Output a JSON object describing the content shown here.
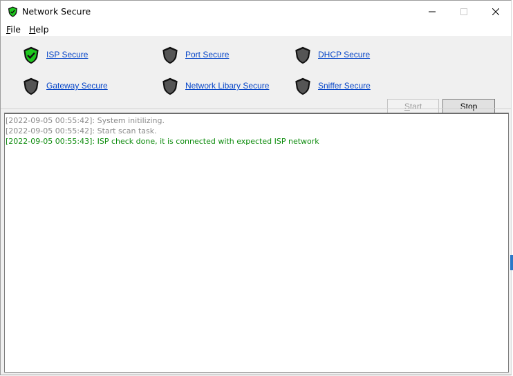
{
  "window": {
    "title": "Network Secure"
  },
  "menu": {
    "items": [
      {
        "accel": "F",
        "rest": "ile"
      },
      {
        "accel": "H",
        "rest": "elp"
      }
    ]
  },
  "checks": [
    {
      "label": "ISP Secure",
      "status": "passed"
    },
    {
      "label": "Port Secure",
      "status": "pending"
    },
    {
      "label": "DHCP Secure",
      "status": "pending"
    },
    {
      "label": "Gateway Secure",
      "status": "pending"
    },
    {
      "label": "Network Libary Secure",
      "status": "pending"
    },
    {
      "label": "Sniffer Secure",
      "status": "pending"
    }
  ],
  "buttons": {
    "start_accel": "S",
    "start_rest": "tart",
    "start_enabled": false,
    "stop_label": "Stop"
  },
  "log": [
    {
      "text": "[2022-09-05 00:55:42]: System initilizing.",
      "color": "#8a8a8a"
    },
    {
      "text": "[2022-09-05 00:55:42]: Start scan task.",
      "color": "#8a8a8a"
    },
    {
      "text": "[2022-09-05 00:55:43]: ISP check done, it is connected with expected ISP network",
      "color": "#0a8a0a"
    }
  ],
  "colors": {
    "link": "#0645c8",
    "shield_ok": "#1ec81e",
    "shield_pending": "#555555",
    "shield_outline": "#111111"
  }
}
